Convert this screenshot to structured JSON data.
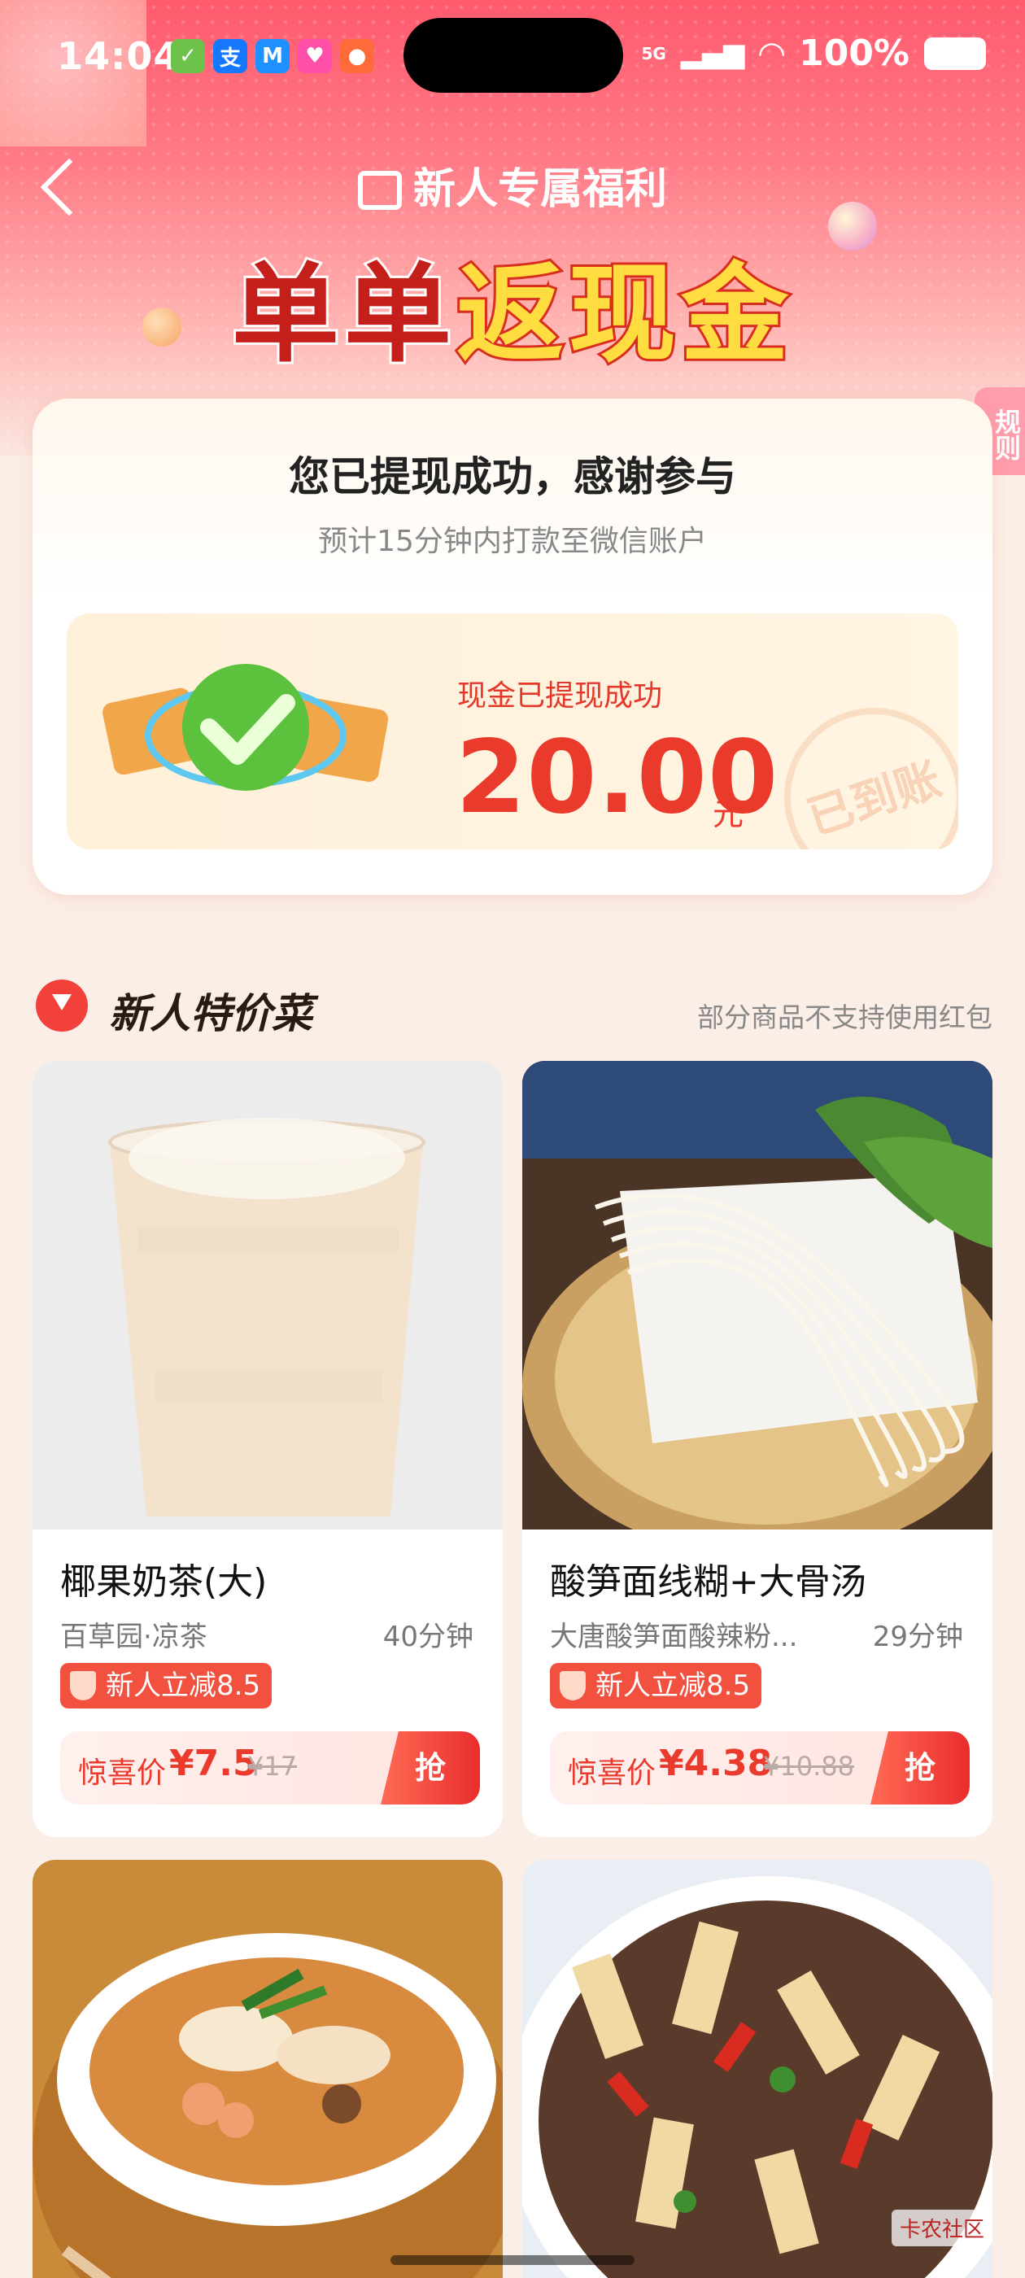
{
  "status_bar": {
    "time": "14:04",
    "network": "5G",
    "battery": "100%",
    "app_icons": [
      {
        "name": "wechat-pay-icon",
        "glyph": "✓",
        "color": "#6cc24a"
      },
      {
        "name": "alipay-icon",
        "glyph": "支",
        "color": "#1677ff"
      },
      {
        "name": "meituan-icon",
        "glyph": "M",
        "color": "#1e90ff"
      },
      {
        "name": "lele-icon",
        "glyph": "♥",
        "color": "#ff4fa8"
      },
      {
        "name": "mascot-icon",
        "glyph": "●",
        "color": "#ff6a3a"
      }
    ]
  },
  "header": {
    "subtitle": "新人专属福利",
    "title_part1": "单单",
    "title_part2": "返现金",
    "rules": "规则"
  },
  "success": {
    "title": "您已提现成功，感谢参与",
    "subtitle": "预计15分钟内打款至微信账户",
    "cash_label": "现金已提现成功",
    "amount": "20.00",
    "unit": "元",
    "stamp": "已到账"
  },
  "section": {
    "title": "新人特价菜",
    "note": "部分商品不支持使用红包"
  },
  "products": [
    {
      "name": "椰果奶茶(大)",
      "shop": "百草园·凉茶",
      "time": "40分钟",
      "badge": "新人立减8.5",
      "price_label": "惊喜价",
      "price_now": "¥7.5",
      "price_old": "¥17",
      "grab": "抢"
    },
    {
      "name": "酸笋面线糊+大骨汤",
      "shop": "大唐酸笋面酸辣粉...",
      "time": "29分钟",
      "badge": "新人立减8.5",
      "price_label": "惊喜价",
      "price_now": "¥4.38",
      "price_old": "¥10.88",
      "grab": "抢"
    }
  ],
  "watermark": "卡农社区"
}
